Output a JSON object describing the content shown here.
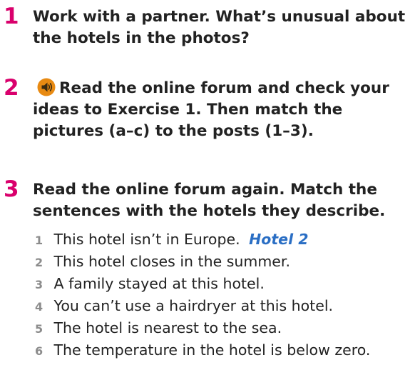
{
  "colors": {
    "exercise_number": "#d9006c",
    "item_number": "#8c8c8c",
    "answer": "#2a6ec4",
    "audio_icon_bg": "#e88a12"
  },
  "exercises": [
    {
      "number": "1",
      "text": "Work with a partner. What’s unusual about the hotels in the photos?"
    },
    {
      "number": "2",
      "icon": "audio-speaker-icon",
      "text": "Read the online forum and check your ideas to Exercise 1. Then match the pictures (a–c) to the posts (1–3)."
    },
    {
      "number": "3",
      "text": "Read the online forum again. Match the sentences with the hotels they describe.",
      "items": [
        {
          "number": "1",
          "text": "This hotel isn’t in Europe.",
          "answer": "Hotel 2"
        },
        {
          "number": "2",
          "text": "This hotel closes in the summer."
        },
        {
          "number": "3",
          "text": "A family stayed at this hotel."
        },
        {
          "number": "4",
          "text": "You can’t use a hairdryer at this hotel."
        },
        {
          "number": "5",
          "text": "The hotel is nearest to the sea."
        },
        {
          "number": "6",
          "text": "The temperature in the hotel is below zero."
        }
      ]
    }
  ]
}
